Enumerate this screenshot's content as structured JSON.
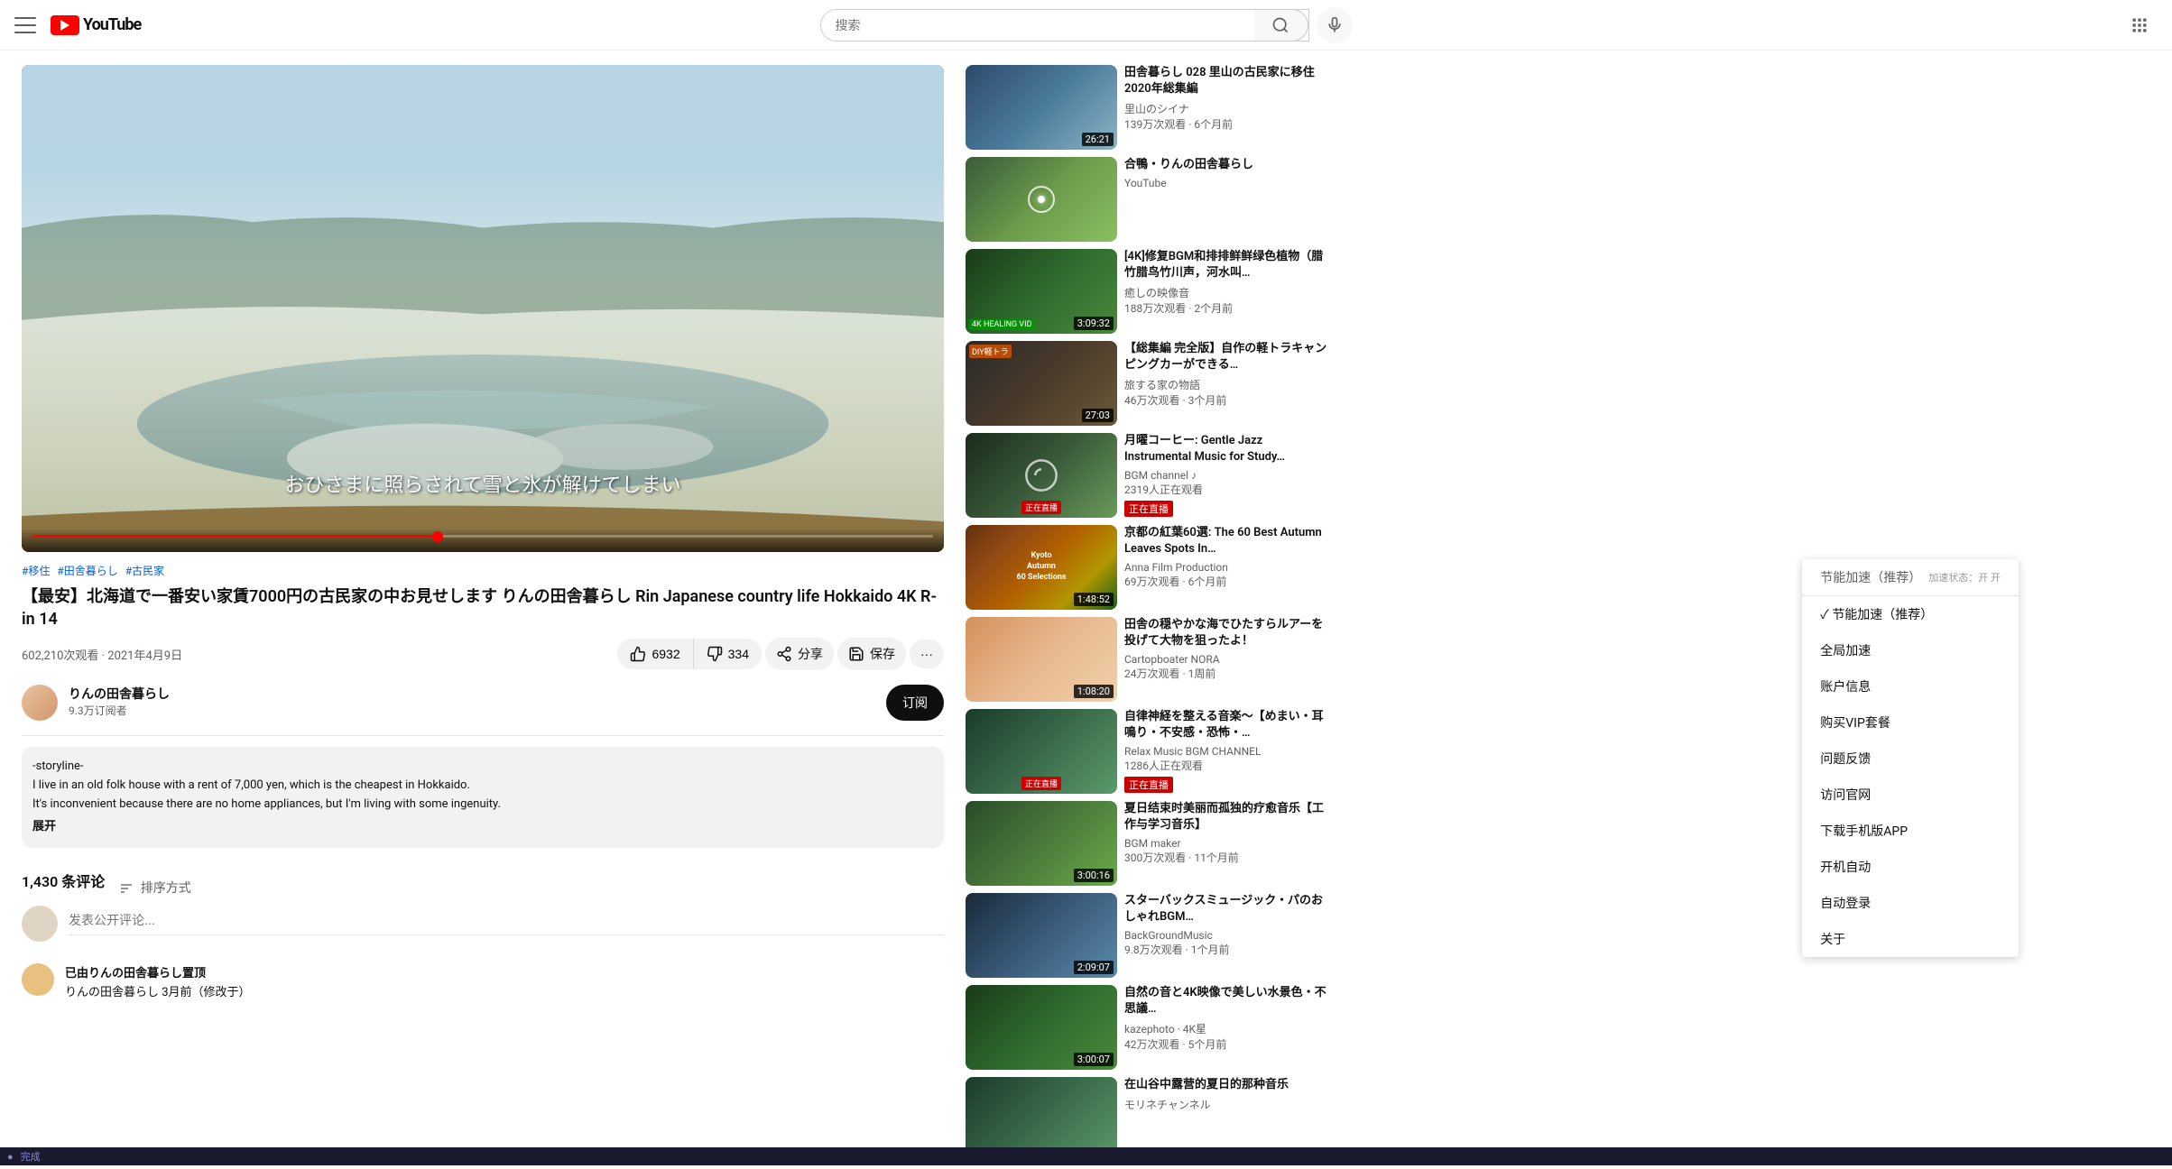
{
  "header": {
    "search_placeholder": "搜索",
    "logo_text": "YouTube"
  },
  "video": {
    "subtitle": "おひさまに照らされて雪と氷が解けてしまい",
    "tags": [
      "#移住",
      "#田舎暮らし",
      "#古民家"
    ],
    "title": "【最安】北海道で一番安い家賃7000円の古民家の中お見せします りんの田舎暮らし Rin Japanese country life Hokkaido 4K R-in 14",
    "views": "602,210次观看",
    "date": "2021年4月9日",
    "like_count": "6932",
    "dislike_count": "334",
    "share_label": "分享",
    "save_label": "保存"
  },
  "channel": {
    "name": "りんの田舎暮らし",
    "subs": "9.3万订阅者",
    "subscribe_label": "订阅",
    "desc_line1": "-storyline-",
    "desc_line2": "I live in an old folk house with a rent of 7,000 yen, which is the cheapest in Hokkaido.",
    "desc_line3": "It's inconvenient because there are no home appliances, but I'm living with some ingenuity.",
    "expand_label": "展开"
  },
  "comments": {
    "count": "1,430 条评论",
    "sort_label": "排序方式",
    "input_placeholder": "发表公开评论...",
    "comment1": {
      "name": "已由りんの田舎暮らし置顶",
      "badge": "",
      "text": "りんの田舎暮らし 3月前（修改于）"
    }
  },
  "sidebar": {
    "items": [
      {
        "title": "田舎暮らし 028 里山の古民家に移住 2020年総集編",
        "channel": "里山のシイナ",
        "meta": "139万次观看 · 6个月前",
        "duration": "26:21",
        "thumb_class": "thumb-1"
      },
      {
        "title": "合鴨・りんの田舎暮らし",
        "channel": "YouTube",
        "meta": "",
        "duration": "",
        "thumb_class": "thumb-2"
      },
      {
        "title": "[4K]修复BGM和排排鲜鲜绿色植物（腊竹腊鸟竹川声，河水叫…",
        "channel": "癒しの映像音",
        "meta": "188万次观看 · 2个月前",
        "duration": "3:09:32",
        "thumb_class": "thumb-3",
        "extra_badge": "4K HEALING VID"
      },
      {
        "title": "【総集編 完全版】自作の軽トラキャンピングカーができる…",
        "channel": "旅する家の物語",
        "meta": "46万次观看 · 3个月前",
        "duration": "27:03",
        "thumb_class": "thumb-4",
        "extra_badge": "DIY軽トラ"
      },
      {
        "title": "月曜コーヒー: Gentle Jazz Instrumental Music for Study…",
        "channel": "BGM channel ♪",
        "meta": "2319人正在观看",
        "duration": "",
        "live": true,
        "thumb_class": "thumb-5"
      },
      {
        "title": "京都の紅葉60選: The 60 Best Autumn Leaves Spots In…",
        "channel": "Anna Film Production",
        "meta": "69万次观看 · 6个月前",
        "duration": "1:48:52",
        "thumb_class": "thumb-kyoto"
      },
      {
        "title": "田舎の穏やかな海でひたすらルアーを投げて大物を狙ったよ！",
        "channel": "Cartopboater NORA",
        "meta": "24万次观看 · 1周前",
        "duration": "1:08:20",
        "thumb_class": "thumb-6"
      },
      {
        "title": "自律神経を整える音楽～【めまい・耳鳴り・不安感・恐怖・…",
        "channel": "Relax Music BGM CHANNEL",
        "meta": "1286人正在观看",
        "duration": "",
        "live": true,
        "thumb_class": "thumb-7"
      },
      {
        "title": "夏日结束时美丽而孤独的疗愈音乐【工作与学习音乐】",
        "channel": "BGM maker",
        "meta": "300万次观看 · 11个月前",
        "duration": "3:00:16",
        "thumb_class": "thumb-8"
      },
      {
        "title": "スターバックスミュージック・パのおしゃれBGM…",
        "channel": "BackGroundMusic",
        "meta": "9.8万次观看 · 1个月前",
        "duration": "2:09:07",
        "thumb_class": "thumb-9"
      },
      {
        "title": "自然の音と4K映像で美しい水景色・不思議…",
        "channel": "kazephoto · 4K星",
        "meta": "42万次观看 · 5个月前",
        "duration": "3:00:07",
        "thumb_class": "thumb-3"
      },
      {
        "title": "在山谷中露营的夏日的那种音乐",
        "channel": "モリネチャンネル",
        "meta": "",
        "duration": "",
        "thumb_class": "thumb-7"
      }
    ]
  },
  "context_menu": {
    "header_text": "节能加速（推荐）",
    "header_subtext": "加速状态：开开",
    "items": [
      "节能加速（推荐）",
      "全局加速",
      "账户信息",
      "购买VIP套餐",
      "问题反馈",
      "访问官网",
      "下载手机版APP",
      "开机自动",
      "自动登录",
      "关于"
    ],
    "checkmark_index": 0
  },
  "status_bar": {
    "icon": "●",
    "text": "完成"
  }
}
